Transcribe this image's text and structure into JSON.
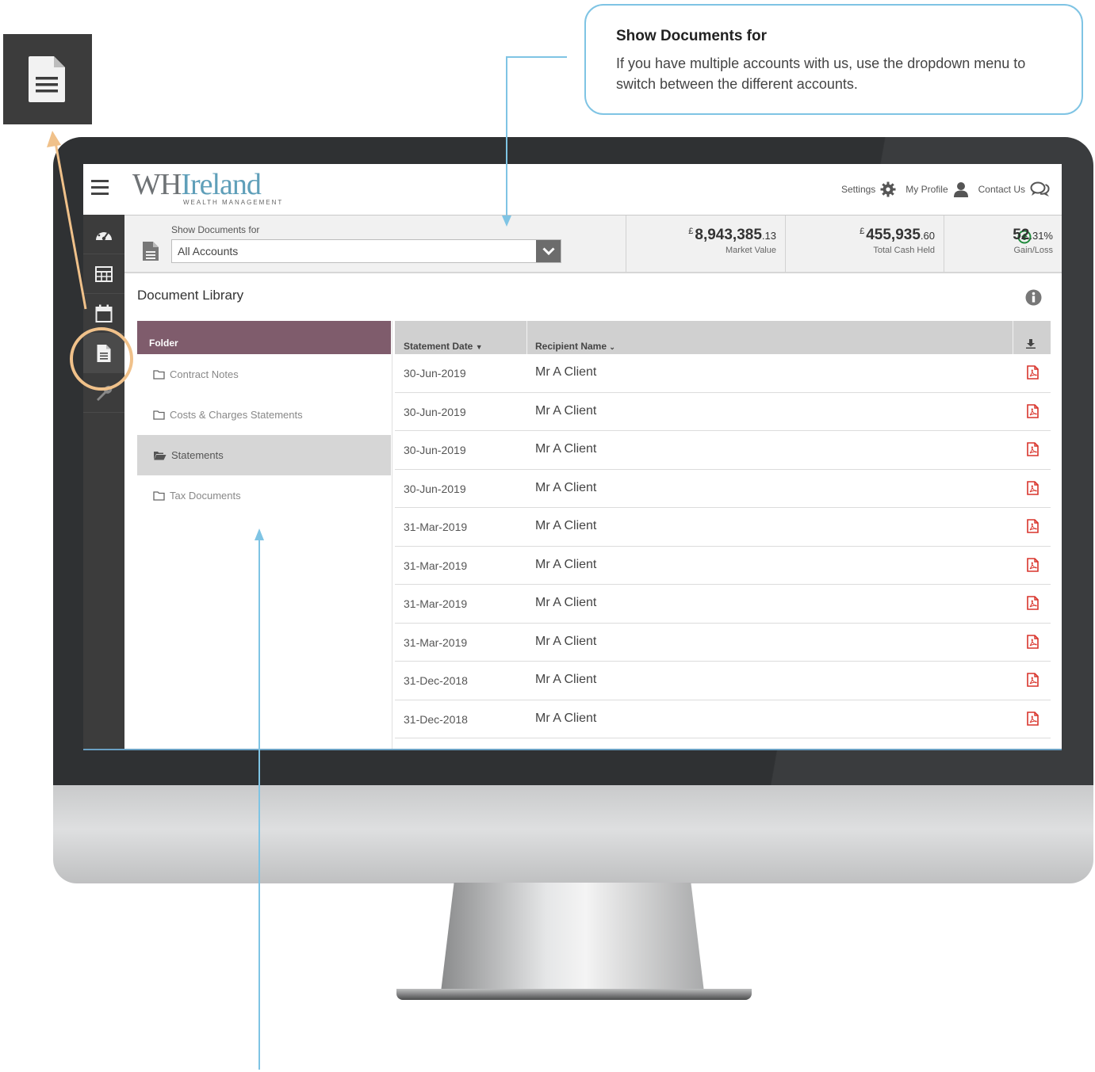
{
  "callout": {
    "title": "Show Documents for",
    "body": "If you have multiple accounts with us, use the dropdown menu to switch between the different accounts."
  },
  "brand": {
    "logo_primary": "WH",
    "logo_accent": "Ireland",
    "logo_sub": "WEALTH MANAGEMENT",
    "accent_color": "#5f9fb9",
    "folder_header_color": "#7f5c6c"
  },
  "topbar": {
    "settings_label": "Settings",
    "profile_label": "My Profile",
    "contact_label": "Contact Us"
  },
  "account_bar": {
    "label": "Show Documents for",
    "selected": "All Accounts",
    "market_value": {
      "currency": "£",
      "whole": "8,943,385",
      "decimal": ".13",
      "label": "Market Value"
    },
    "cash_held": {
      "currency": "£",
      "whole": "455,935",
      "decimal": ".60",
      "label": "Total Cash Held"
    },
    "gain_loss": {
      "whole": "52",
      "decimal": ".31%",
      "label": "Gain/Loss"
    }
  },
  "library": {
    "title": "Document Library",
    "folder_header": "Folder",
    "folders": [
      {
        "label": "Contract Notes",
        "icon": "folder-outline-icon",
        "active": false
      },
      {
        "label": "Costs & Charges Statements",
        "icon": "folder-outline-icon",
        "active": false
      },
      {
        "label": "Statements",
        "icon": "folder-open-icon",
        "active": true
      },
      {
        "label": "Tax Documents",
        "icon": "folder-outline-icon",
        "active": false
      }
    ],
    "columns": {
      "date": "Statement Date",
      "name": "Recipient Name"
    },
    "rows": [
      {
        "date": "30-Jun-2019",
        "name": "Mr A Client"
      },
      {
        "date": "30-Jun-2019",
        "name": "Mr A Client"
      },
      {
        "date": "30-Jun-2019",
        "name": "Mr A Client"
      },
      {
        "date": "30-Jun-2019",
        "name": "Mr A Client"
      },
      {
        "date": "31-Mar-2019",
        "name": "Mr A Client"
      },
      {
        "date": "31-Mar-2019",
        "name": "Mr A Client"
      },
      {
        "date": "31-Mar-2019",
        "name": "Mr A Client"
      },
      {
        "date": "31-Mar-2019",
        "name": "Mr A Client"
      },
      {
        "date": "31-Dec-2018",
        "name": "Mr A Client"
      },
      {
        "date": "31-Dec-2018",
        "name": "Mr A Client"
      }
    ]
  }
}
